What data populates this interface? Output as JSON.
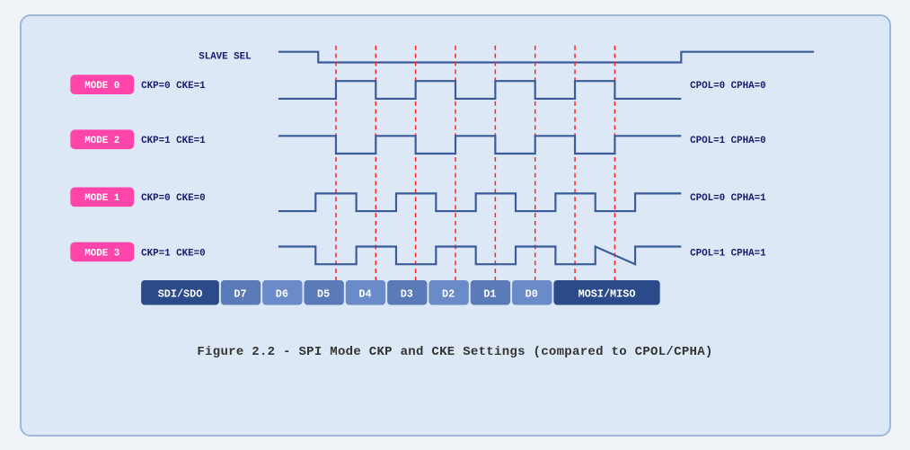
{
  "caption": "Figure 2.2 - SPI Mode CKP and CKE Settings (compared to CPOL/CPHA)",
  "modes": [
    {
      "label": "MODE 0",
      "ckp_cke": "CKP=0  CKE=1",
      "cpol_cpha": "CPOL=0  CPHA=0"
    },
    {
      "label": "MODE 2",
      "ckp_cke": "CKP=1  CKE=1",
      "cpol_cpha": "CPOL=1  CPHA=0"
    },
    {
      "label": "MODE 1",
      "ckp_cke": "CKP=0  CKE=0",
      "cpol_cpha": "CPOL=0  CPHA=1"
    },
    {
      "label": "MODE 3",
      "ckp_cke": "CKP=1  CKE=0",
      "cpol_cpha": "CPOL=1  CPHA=1"
    }
  ],
  "data_bits": [
    "SDI/SDO",
    "D7",
    "D6",
    "D5",
    "D4",
    "D3",
    "D2",
    "D1",
    "D0",
    "MOSI/MISO"
  ],
  "slave_sel_label": "SLAVE SEL"
}
